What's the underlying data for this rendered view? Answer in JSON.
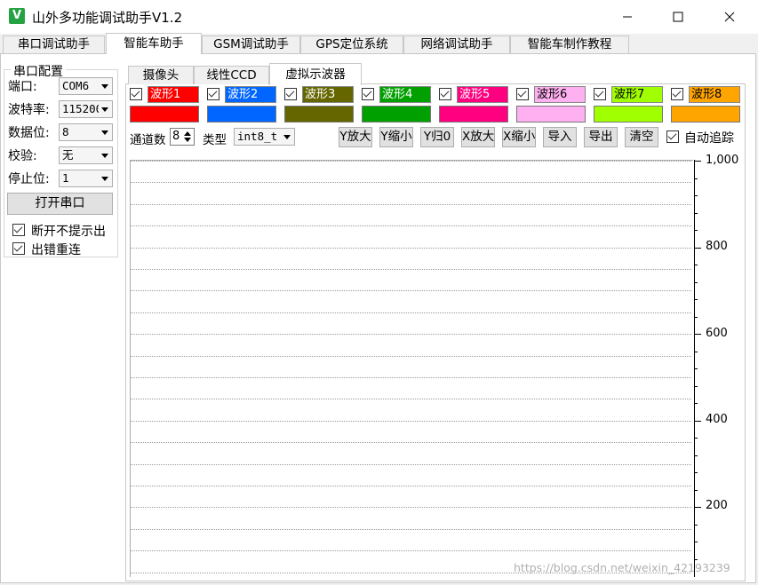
{
  "window": {
    "title": "山外多功能调试助手V1.2",
    "icon_letter": "V"
  },
  "main_tabs": [
    {
      "label": "串口调试助手"
    },
    {
      "label": "智能车助手"
    },
    {
      "label": "GSM调试助手"
    },
    {
      "label": "GPS定位系统"
    },
    {
      "label": "网络调试助手"
    },
    {
      "label": "智能车制作教程"
    }
  ],
  "serial_config": {
    "legend": "串口配置",
    "fields": [
      {
        "label": "端口:",
        "value": "COM6"
      },
      {
        "label": "波特率:",
        "value": "115200"
      },
      {
        "label": "数据位:",
        "value": "8"
      },
      {
        "label": "校验:",
        "value": "无"
      },
      {
        "label": "停止位:",
        "value": "1"
      }
    ],
    "open_button": "打开串口",
    "options": [
      {
        "label": "断开不提示出",
        "checked": true
      },
      {
        "label": "出错重连",
        "checked": true
      }
    ]
  },
  "sub_tabs": [
    {
      "label": "摄像头"
    },
    {
      "label": "线性CCD"
    },
    {
      "label": "虚拟示波器"
    }
  ],
  "waveforms": [
    {
      "name": "波形1",
      "color": "#ff0000",
      "checked": true
    },
    {
      "name": "波形2",
      "color": "#0066ff",
      "checked": true
    },
    {
      "name": "波形3",
      "color": "#666600",
      "checked": true
    },
    {
      "name": "波形4",
      "color": "#00a000",
      "checked": true
    },
    {
      "name": "波形5",
      "color": "#ff0080",
      "checked": true
    },
    {
      "name": "波形6",
      "color": "#ffb0f0",
      "checked": true
    },
    {
      "name": "波形7",
      "color": "#a0ff00",
      "checked": true
    },
    {
      "name": "波形8",
      "color": "#ffa500",
      "checked": true
    }
  ],
  "toolbar": {
    "channel_label": "通道数",
    "channel_value": "8",
    "type_label": "类型",
    "type_value": "int8_t",
    "buttons": [
      "Y放大",
      "Y缩小",
      "Y归0",
      "X放大",
      "X缩小",
      "导入",
      "导出",
      "清空"
    ],
    "auto_track_label": "自动追踪",
    "auto_track_checked": true
  },
  "plot": {
    "y_labels": [
      "1,000",
      "800",
      "600",
      "400",
      "200"
    ],
    "watermark": "https://blog.csdn.net/weixin_42193239"
  }
}
